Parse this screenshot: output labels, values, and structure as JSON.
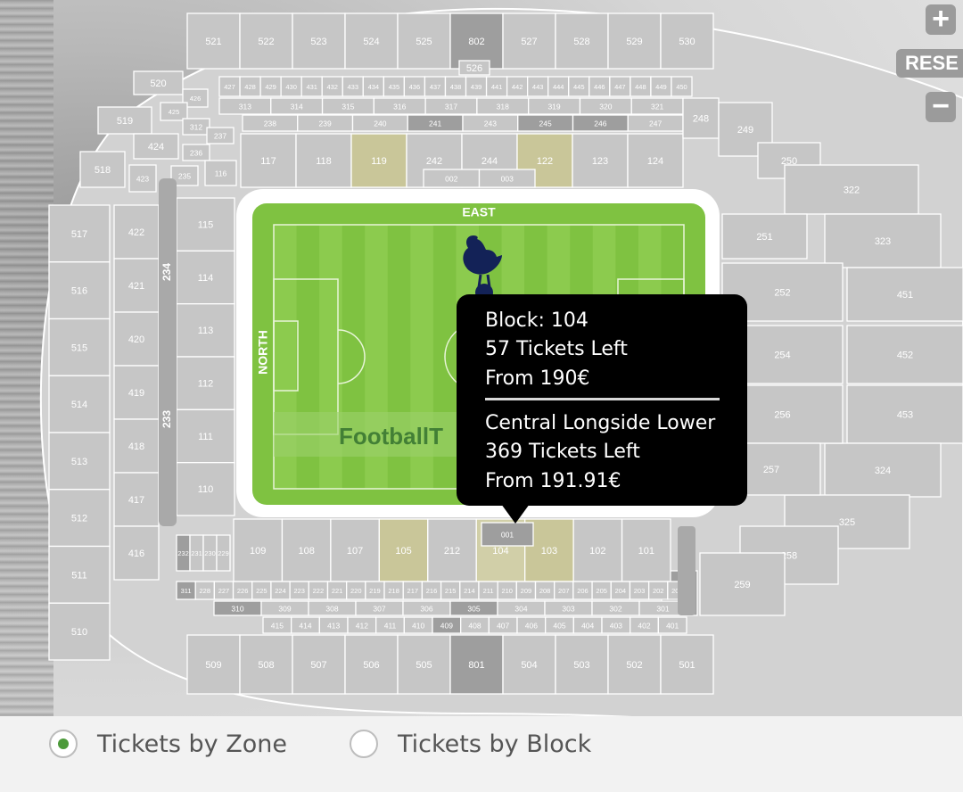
{
  "controls": {
    "zoom_in_label": "+",
    "reset_label": "RESE",
    "zoom_out_label": "−"
  },
  "pitch": {
    "east_label": "EAST",
    "north_label": "NORTH",
    "watermark": "FootballT"
  },
  "tooltip": {
    "block_line": "Block: 104",
    "block_tickets": "57 Tickets Left",
    "block_price": "From 190€",
    "zone_name": "Central Longside Lower",
    "zone_tickets": "369 Tickets Left",
    "zone_price": "From 191.91€"
  },
  "legend": {
    "zone_label": "Tickets by Zone",
    "block_label": "Tickets by Block",
    "selected": "zone"
  },
  "colors": {
    "pitch_green": "#7fc241",
    "section_grey": "#c6c6c6",
    "available_highlight": "#c9c699",
    "selected_radio": "#4c9a3a",
    "tooltip_bg": "#000000"
  },
  "sections": {
    "top_upper": [
      "521",
      "522",
      "523",
      "524",
      "525",
      "802",
      "527",
      "528",
      "529",
      "530"
    ],
    "top_upper_inner": [
      "526"
    ],
    "top_club_row": [
      "427",
      "428",
      "429",
      "430",
      "431",
      "432",
      "433",
      "434",
      "435",
      "436",
      "437",
      "438",
      "439",
      "441",
      "442",
      "443",
      "444",
      "445",
      "446",
      "447",
      "448",
      "449",
      "450"
    ],
    "top_300_row": [
      "313",
      "314",
      "315",
      "316",
      "317",
      "318",
      "319",
      "320",
      "321"
    ],
    "top_200_row": [
      "238",
      "239",
      "240",
      "241",
      "243",
      "245",
      "246",
      "247"
    ],
    "top_lower": [
      "117",
      "118",
      "119",
      "242",
      "244",
      "122",
      "123",
      "124"
    ],
    "top_low_inner": [
      "002",
      "003"
    ],
    "corner_nw": [
      "520",
      "519",
      "518",
      "426",
      "425",
      "424",
      "423",
      "312",
      "237",
      "236",
      "235",
      "116",
      "248",
      "249",
      "250"
    ],
    "west_upper": [
      "517",
      "516",
      "515",
      "514",
      "513",
      "512",
      "511",
      "510"
    ],
    "west_400": [
      "422",
      "421",
      "420",
      "419",
      "418",
      "417",
      "416"
    ],
    "west_aisles": [
      "234",
      "233"
    ],
    "west_lower": [
      "115",
      "114",
      "113",
      "112",
      "111",
      "110"
    ],
    "east_side": [
      "322",
      "323",
      "451",
      "452",
      "453",
      "324",
      "325",
      "251",
      "252",
      "254",
      "256",
      "257",
      "258",
      "259",
      "260"
    ],
    "south_lower": [
      "232",
      "231",
      "230",
      "229",
      "109",
      "108",
      "107",
      "105",
      "212",
      "104",
      "103",
      "102",
      "101"
    ],
    "south_200_row": [
      "311",
      "228",
      "227",
      "226",
      "225",
      "224",
      "223",
      "222",
      "221",
      "220",
      "219",
      "218",
      "217",
      "216",
      "215",
      "214",
      "211",
      "210",
      "209",
      "208",
      "207",
      "206",
      "205",
      "204",
      "203",
      "202",
      "201"
    ],
    "south_300_row": [
      "310",
      "309",
      "308",
      "307",
      "306",
      "305",
      "304",
      "303",
      "302",
      "301"
    ],
    "south_400_row": [
      "415",
      "414",
      "413",
      "412",
      "411",
      "410",
      "409",
      "408",
      "407",
      "406",
      "405",
      "404",
      "403",
      "402",
      "401"
    ],
    "south_upper": [
      "509",
      "508",
      "507",
      "506",
      "505",
      "801",
      "504",
      "503",
      "502",
      "501"
    ],
    "south_inner": [
      "001"
    ]
  }
}
